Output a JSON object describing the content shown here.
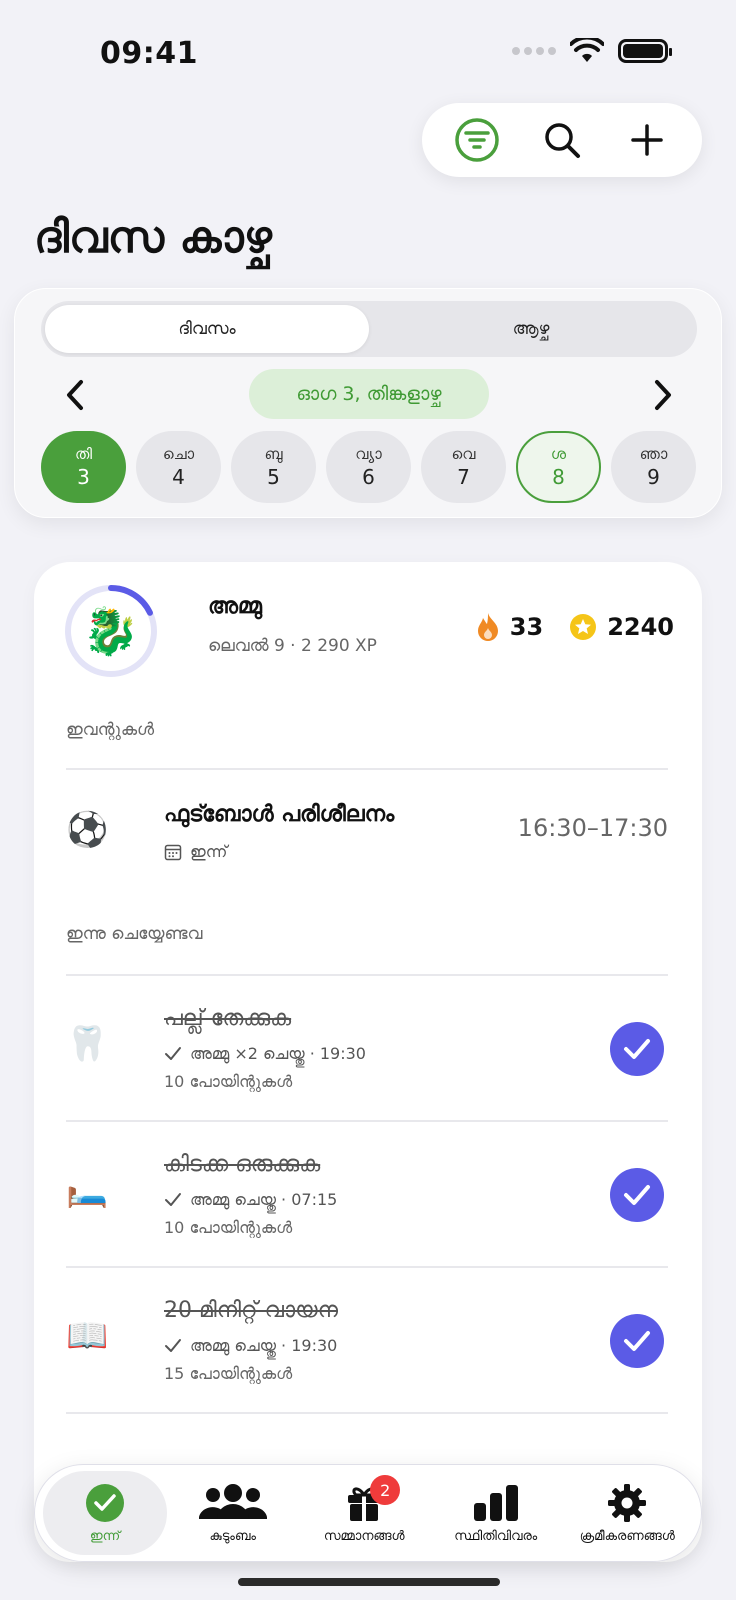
{
  "status_bar": {
    "time": "09:41"
  },
  "header": {
    "title": "ദിവസ കാഴ്ച",
    "actions": {
      "filter_icon": "filter-icon",
      "search_icon": "search-icon",
      "add_icon": "plus-icon"
    }
  },
  "calendar": {
    "segments": [
      {
        "label": "ദിവസം",
        "active": true
      },
      {
        "label": "ആഴ്ച",
        "active": false
      }
    ],
    "current_date": "ഓഗ 3, തിങ്കളാഴ്ച",
    "days": [
      {
        "label": "തി",
        "num": "3",
        "state": "selected"
      },
      {
        "label": "ചൊ",
        "num": "4",
        "state": ""
      },
      {
        "label": "ബു",
        "num": "5",
        "state": ""
      },
      {
        "label": "വ്യാ",
        "num": "6",
        "state": ""
      },
      {
        "label": "വെ",
        "num": "7",
        "state": ""
      },
      {
        "label": "ശ",
        "num": "8",
        "state": "today"
      },
      {
        "label": "ഞാ",
        "num": "9",
        "state": ""
      }
    ]
  },
  "profile": {
    "name": "അമ്മു",
    "subtitle": "ലെവൽ 9 · 2 290 XP",
    "streak": "33",
    "points": "2240",
    "level_progress": 0.18
  },
  "events": {
    "label": "ഇവന്റുകൾ",
    "items": [
      {
        "emoji": "⚽",
        "title": "ഫുട്ബോൾ പരിശീലനം",
        "when": "ഇന്ന്",
        "time": "16:30–17:30"
      }
    ]
  },
  "todos": {
    "label": "ഇന്നു ചെയ്യേണ്ടവ",
    "items": [
      {
        "emoji": "🦷",
        "title": "പല്ല് തേക്കുക",
        "meta": "അമ്മു ×2 ചെയ്തു · 19:30",
        "points": "10 പോയിന്റുകൾ",
        "done": true
      },
      {
        "emoji": "🛏️",
        "title": "കിടക്ക ഒരുക്കുക",
        "meta": "അമ്മു ചെയ്തു · 07:15",
        "points": "10 പോയിന്റുകൾ",
        "done": true
      },
      {
        "emoji": "📖",
        "title": "20 മിനിറ്റ് വായന",
        "meta": "അമ്മു ചെയ്തു · 19:30",
        "points": "15 പോയിന്റുകൾ",
        "done": true
      }
    ]
  },
  "tab_bar": {
    "tabs": [
      {
        "label": "ഇന്ന്",
        "icon": "check-circle-icon",
        "active": true
      },
      {
        "label": "കുടുംബം",
        "icon": "people-icon",
        "active": false
      },
      {
        "label": "സമ്മാനങ്ങൾ",
        "icon": "gift-icon",
        "active": false,
        "badge": "2"
      },
      {
        "label": "സ്ഥിതിവിവരം",
        "icon": "chart-icon",
        "active": false
      },
      {
        "label": "ക്രമീകരണങ്ങൾ",
        "icon": "gear-icon",
        "active": false
      }
    ]
  },
  "colors": {
    "green": "#4a9f3c",
    "purple": "#5b5be6",
    "badge": "#ef3b3b",
    "streak": "#f08a24",
    "star": "#f5c518"
  }
}
